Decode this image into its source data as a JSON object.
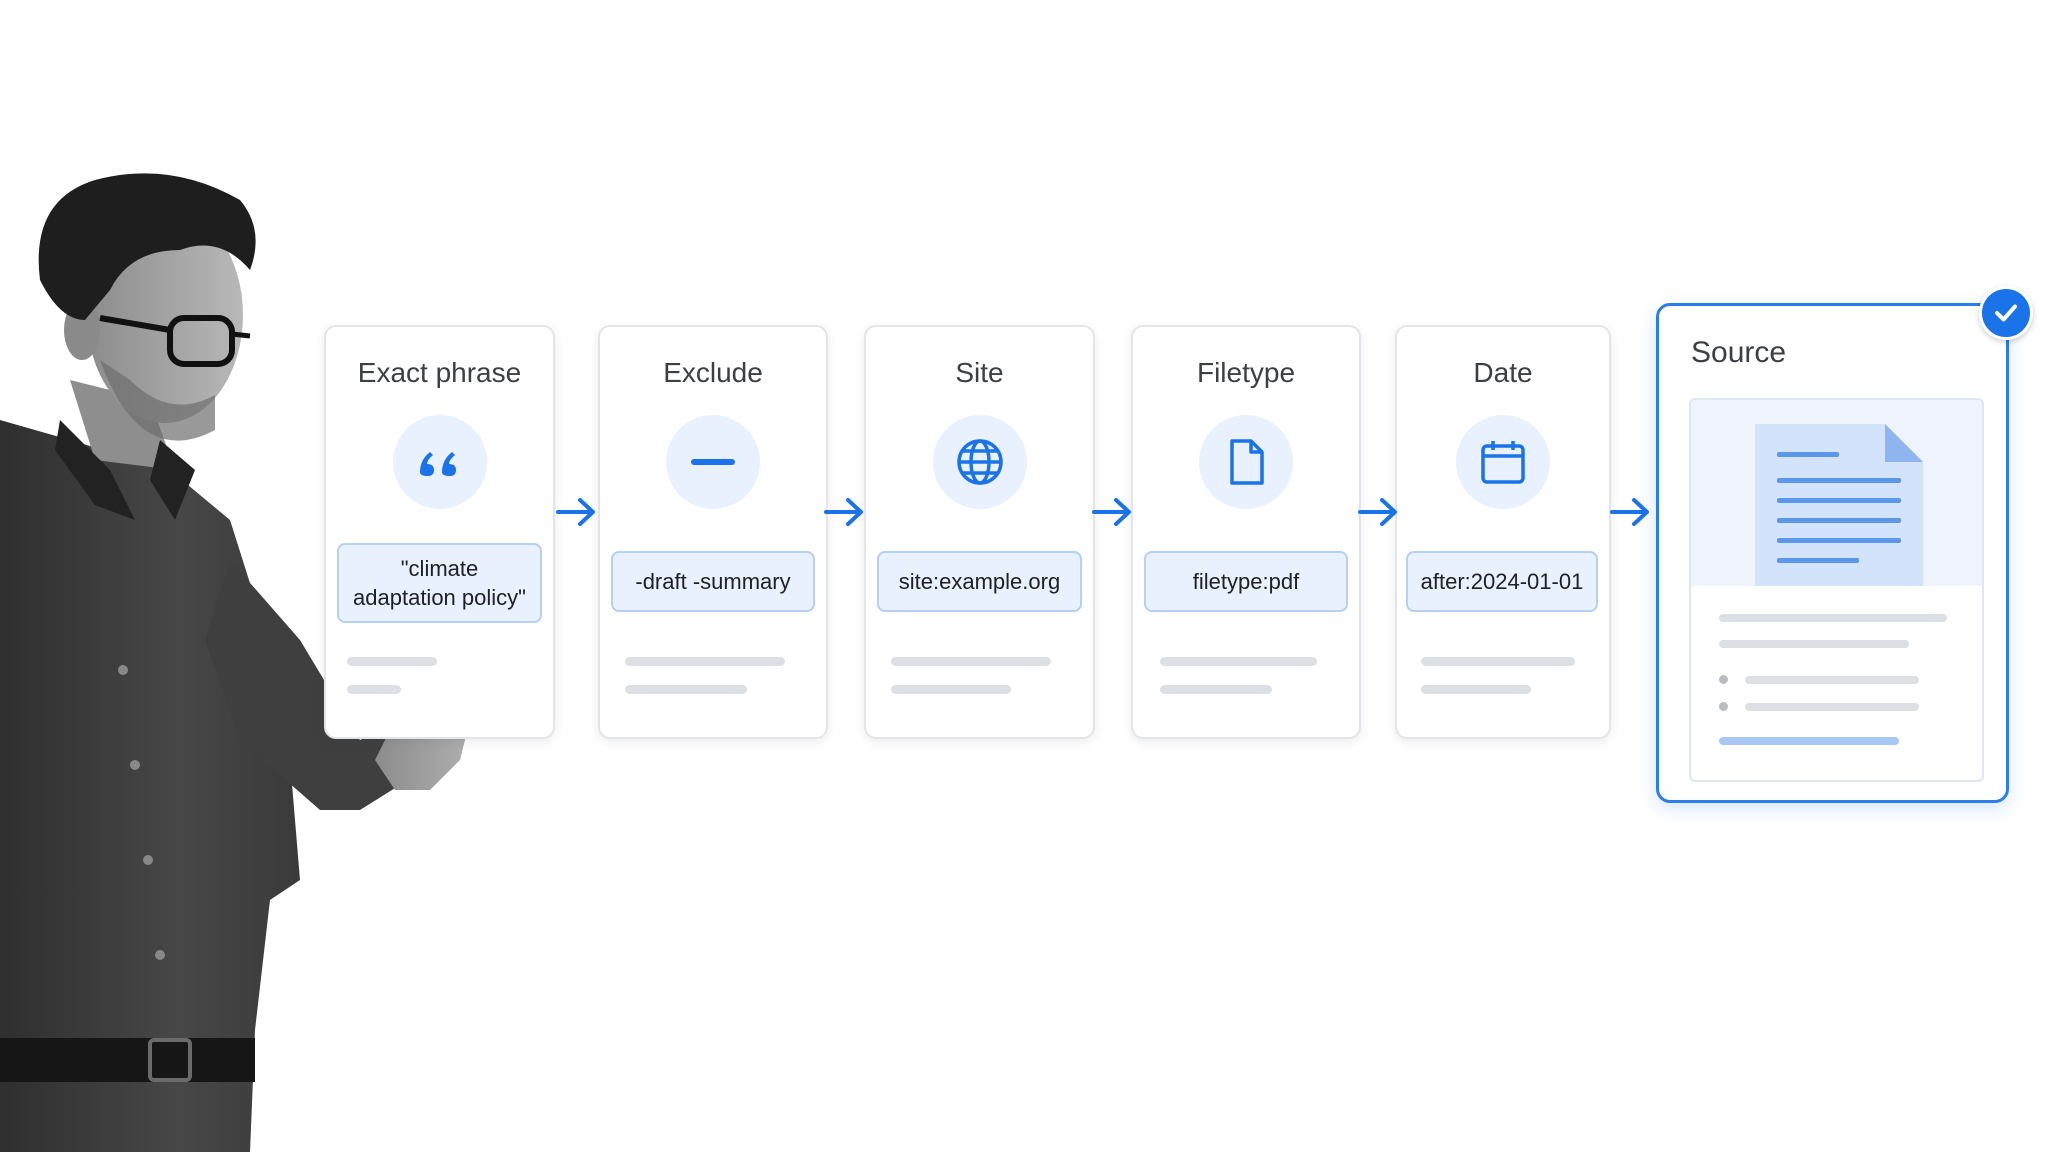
{
  "steps": [
    {
      "title": "Exact phrase",
      "icon": "quote-icon",
      "query": "\"climate adaptation policy\""
    },
    {
      "title": "Exclude",
      "icon": "minus-icon",
      "query": "-draft -summary"
    },
    {
      "title": "Site",
      "icon": "globe-icon",
      "query": "site:example.org"
    },
    {
      "title": "Filetype",
      "icon": "file-icon",
      "query": "filetype:pdf"
    },
    {
      "title": "Date",
      "icon": "calendar-icon",
      "query": "after:2024-01-01"
    }
  ],
  "result": {
    "title": "Source",
    "icon": "document-icon",
    "status_icon": "check-icon"
  },
  "colors": {
    "accent": "#1a73e8",
    "icon_background": "#e9f1fe",
    "query_border": "#b6cff4",
    "card_border": "#e3e5e8",
    "placeholder_line": "#dcdfe3"
  }
}
